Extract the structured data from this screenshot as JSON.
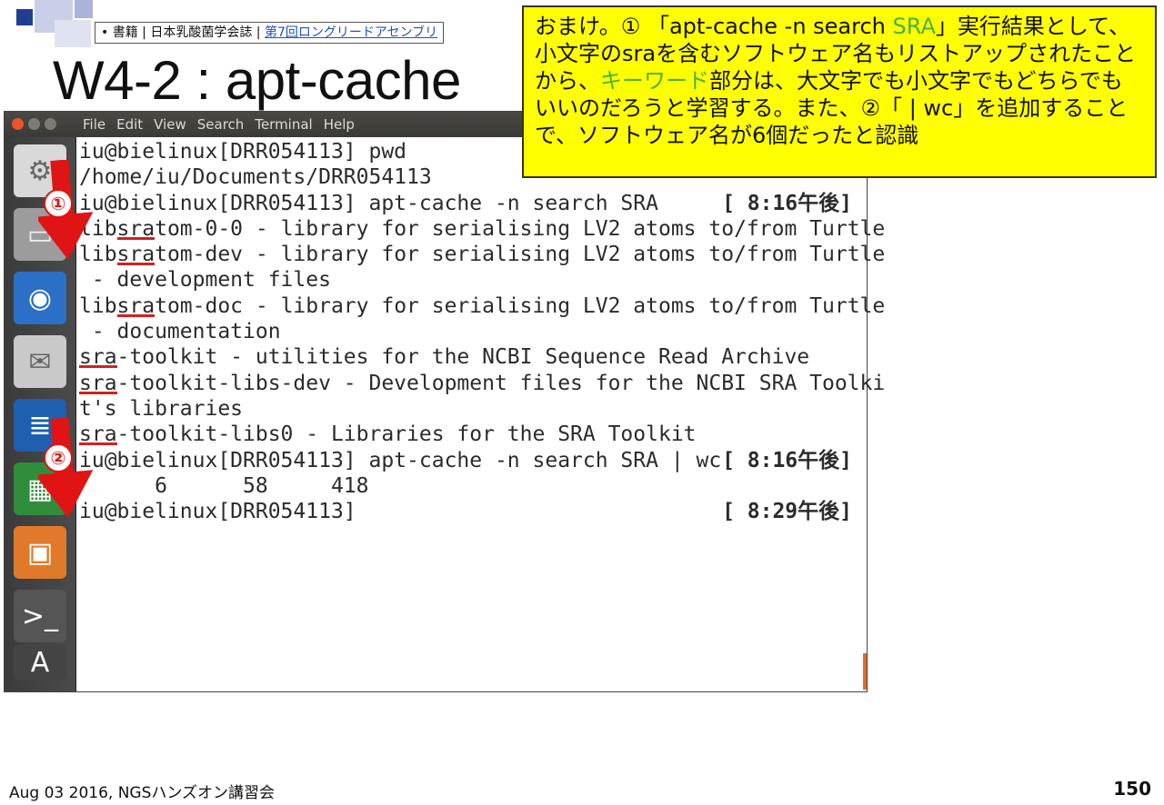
{
  "ref": {
    "bullet": "•",
    "text": "書籍 | 日本乳酸菌学会誌 |",
    "link": "第7回ロングリードアセンブリ"
  },
  "slide_title": "W4-2 : apt-cache",
  "terminal": {
    "menu": [
      "File",
      "Edit",
      "View",
      "Search",
      "Terminal",
      "Help"
    ],
    "lines": [
      {
        "text": "iu@bielinux[DRR054113] pwd"
      },
      {
        "text": "/home/iu/Documents/DRR054113"
      },
      {
        "text": "iu@bielinux[DRR054113] apt-cache -n search SRA",
        "ts": "[ 8:16午後]"
      },
      {
        "pre": "lib",
        "hl": "sra",
        "post": "tom-0-0 - library for serialising LV2 atoms to/from Turtle"
      },
      {
        "pre": "lib",
        "hl": "sra",
        "post": "tom-dev - library for serialising LV2 atoms to/from Turtle"
      },
      {
        "text": " - development files"
      },
      {
        "pre": "lib",
        "hl": "sra",
        "post": "tom-doc - library for serialising LV2 atoms to/from Turtle"
      },
      {
        "text": " - documentation"
      },
      {
        "pre": "",
        "hl": "sra",
        "post": "-toolkit - utilities for the NCBI Sequence Read Archive"
      },
      {
        "pre": "",
        "hl": "sra",
        "post": "-toolkit-libs-dev - Development files for the NCBI SRA Toolki"
      },
      {
        "text": "t's libraries"
      },
      {
        "pre": "",
        "hl": "sra",
        "post": "-toolkit-libs0 - Libraries for the SRA Toolkit"
      },
      {
        "text": "iu@bielinux[DRR054113] apt-cache -n search SRA | wc",
        "ts": "[ 8:16午後]"
      },
      {
        "text": "      6      58     418"
      },
      {
        "text": "iu@bielinux[DRR054113]",
        "ts": "[ 8:29午後]"
      }
    ]
  },
  "markers": [
    "①",
    "②"
  ],
  "note": {
    "p1": "おまけ。① 「apt-cache -n search ",
    "p1_green": "SRA",
    "p2": "」実行結果として、小文字のsraを含むソフトウェア名もリストアップされたことから、",
    "p2_green": "キーワード",
    "p3": "部分は、大文字でも小文字でもどちらでもいいのだろうと学習する。また、②「 | wc」を追加することで、ソフトウェア名が6個だったと認識"
  },
  "footer": {
    "left": "Aug 03 2016, NGSハンズオン講習会",
    "page": "150"
  }
}
